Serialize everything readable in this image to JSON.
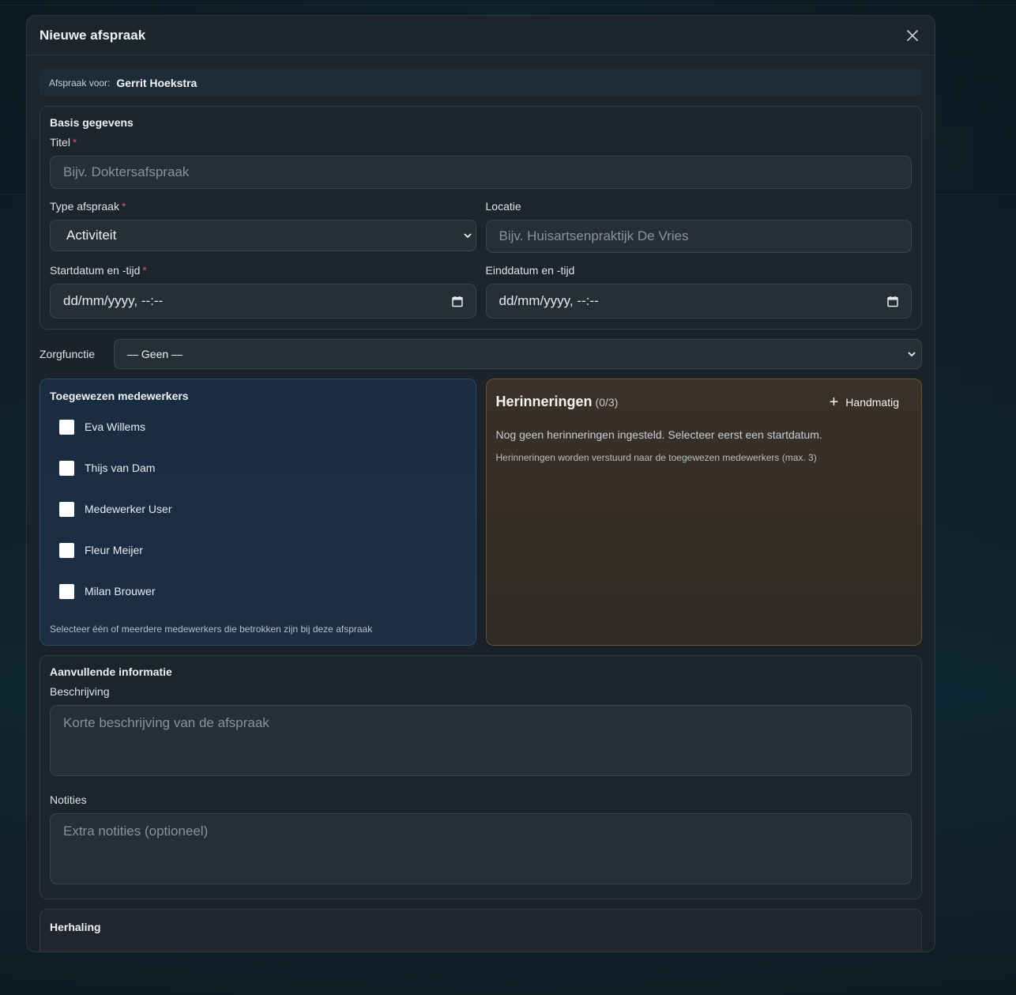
{
  "modal": {
    "title": "Nieuwe afspraak",
    "for_label": "Afspraak voor:",
    "for_name": "Gerrit Hoekstra"
  },
  "basis": {
    "title": "Basis gegevens",
    "titel_label": "Titel",
    "titel_placeholder": "Bijv. Doktersafspraak",
    "type_label": "Type afspraak",
    "type_value": "Activiteit",
    "locatie_label": "Locatie",
    "locatie_placeholder": "Bijv. Huisartsenpraktijk De Vries",
    "start_label": "Startdatum en -tijd",
    "start_value": "dd/mm/yyyy, --:--",
    "end_label": "Einddatum en -tijd",
    "end_value": "dd/mm/yyyy, --:--",
    "required_mark": "*"
  },
  "zorg": {
    "label": "Zorgfunctie",
    "value": "— Geen —"
  },
  "staff": {
    "title": "Toegewezen medewerkers",
    "items": [
      {
        "name": "Eva Willems",
        "checked": false
      },
      {
        "name": "Thijs van Dam",
        "checked": false
      },
      {
        "name": "Medewerker User",
        "checked": false
      },
      {
        "name": "Fleur Meijer",
        "checked": false
      },
      {
        "name": "Milan Brouwer",
        "checked": false
      }
    ],
    "hint": "Selecteer één of meerdere medewerkers die betrokken zijn bij deze afspraak"
  },
  "reminders": {
    "title": "Herinneringen",
    "count": "(0/3)",
    "manual_label": "Handmatig",
    "empty": "Nog geen herinneringen ingesteld. Selecteer eerst een startdatum.",
    "hint": "Herinneringen worden verstuurd naar de toegewezen medewerkers (max. 3)"
  },
  "extra": {
    "title": "Aanvullende informatie",
    "desc_label": "Beschrijving",
    "desc_placeholder": "Korte beschrijving van de afspraak",
    "notes_label": "Notities",
    "notes_placeholder": "Extra notities (optioneel)"
  },
  "repeat": {
    "title": "Herhaling"
  }
}
